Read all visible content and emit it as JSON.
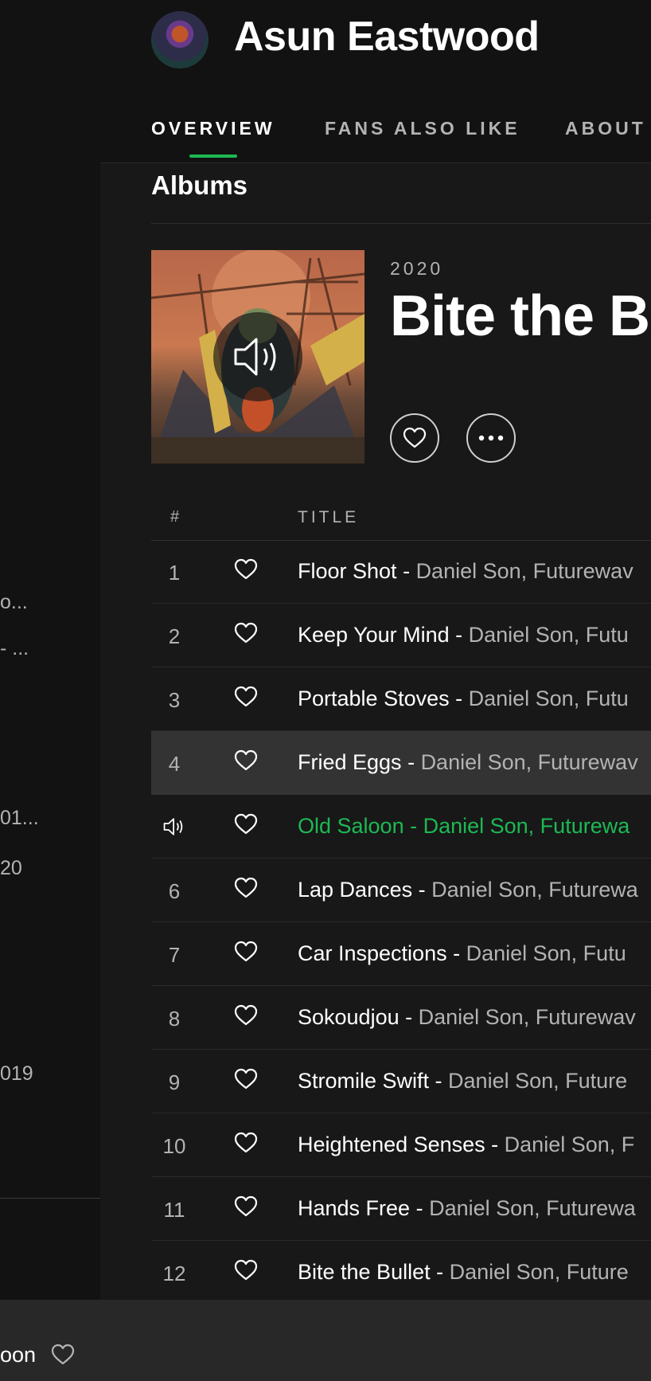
{
  "sidebar": {
    "fragments": [
      "o...",
      "- ...",
      "01...",
      "20",
      "019"
    ]
  },
  "header": {
    "artist_name": "Asun Eastwood",
    "tabs": [
      {
        "label": "OVERVIEW",
        "active": true
      },
      {
        "label": "FANS ALSO LIKE",
        "active": false
      },
      {
        "label": "ABOUT",
        "active": false
      }
    ]
  },
  "albums": {
    "heading": "Albums",
    "album": {
      "year": "2020",
      "title": "Bite the Bu"
    },
    "columns": {
      "number": "#",
      "title": "TITLE"
    },
    "tracks": [
      {
        "num": "1",
        "name": "Floor Shot",
        "artists": "Daniel Son, Futurewav"
      },
      {
        "num": "2",
        "name": "Keep Your Mind",
        "artists": "Daniel Son, Futu"
      },
      {
        "num": "3",
        "name": "Portable Stoves",
        "artists": "Daniel Son, Futu"
      },
      {
        "num": "4",
        "name": "Fried Eggs",
        "artists": "Daniel Son, Futurewav"
      },
      {
        "num": "",
        "name": "Old Saloon",
        "artists": "Daniel Son, Futurewa"
      },
      {
        "num": "6",
        "name": "Lap Dances",
        "artists": "Daniel Son, Futurewa"
      },
      {
        "num": "7",
        "name": "Car Inspections",
        "artists": "Daniel Son, Futu"
      },
      {
        "num": "8",
        "name": "Sokoudjou",
        "artists": "Daniel Son, Futurewav"
      },
      {
        "num": "9",
        "name": "Stromile Swift",
        "artists": "Daniel Son, Future"
      },
      {
        "num": "10",
        "name": "Heightened Senses",
        "artists": "Daniel Son, F"
      },
      {
        "num": "11",
        "name": "Hands Free",
        "artists": "Daniel Son, Futurewa"
      },
      {
        "num": "12",
        "name": "Bite the Bullet",
        "artists": "Daniel Son, Future"
      }
    ]
  },
  "player": {
    "track_fragment": "oon"
  },
  "colors": {
    "accent": "#1db954",
    "background": "#181818",
    "sidebar": "#121212",
    "player": "#282828",
    "row_hover": "#333333"
  },
  "icons": {
    "like": "heart-icon",
    "more": "more-dots-icon",
    "playing": "speaker-icon"
  }
}
